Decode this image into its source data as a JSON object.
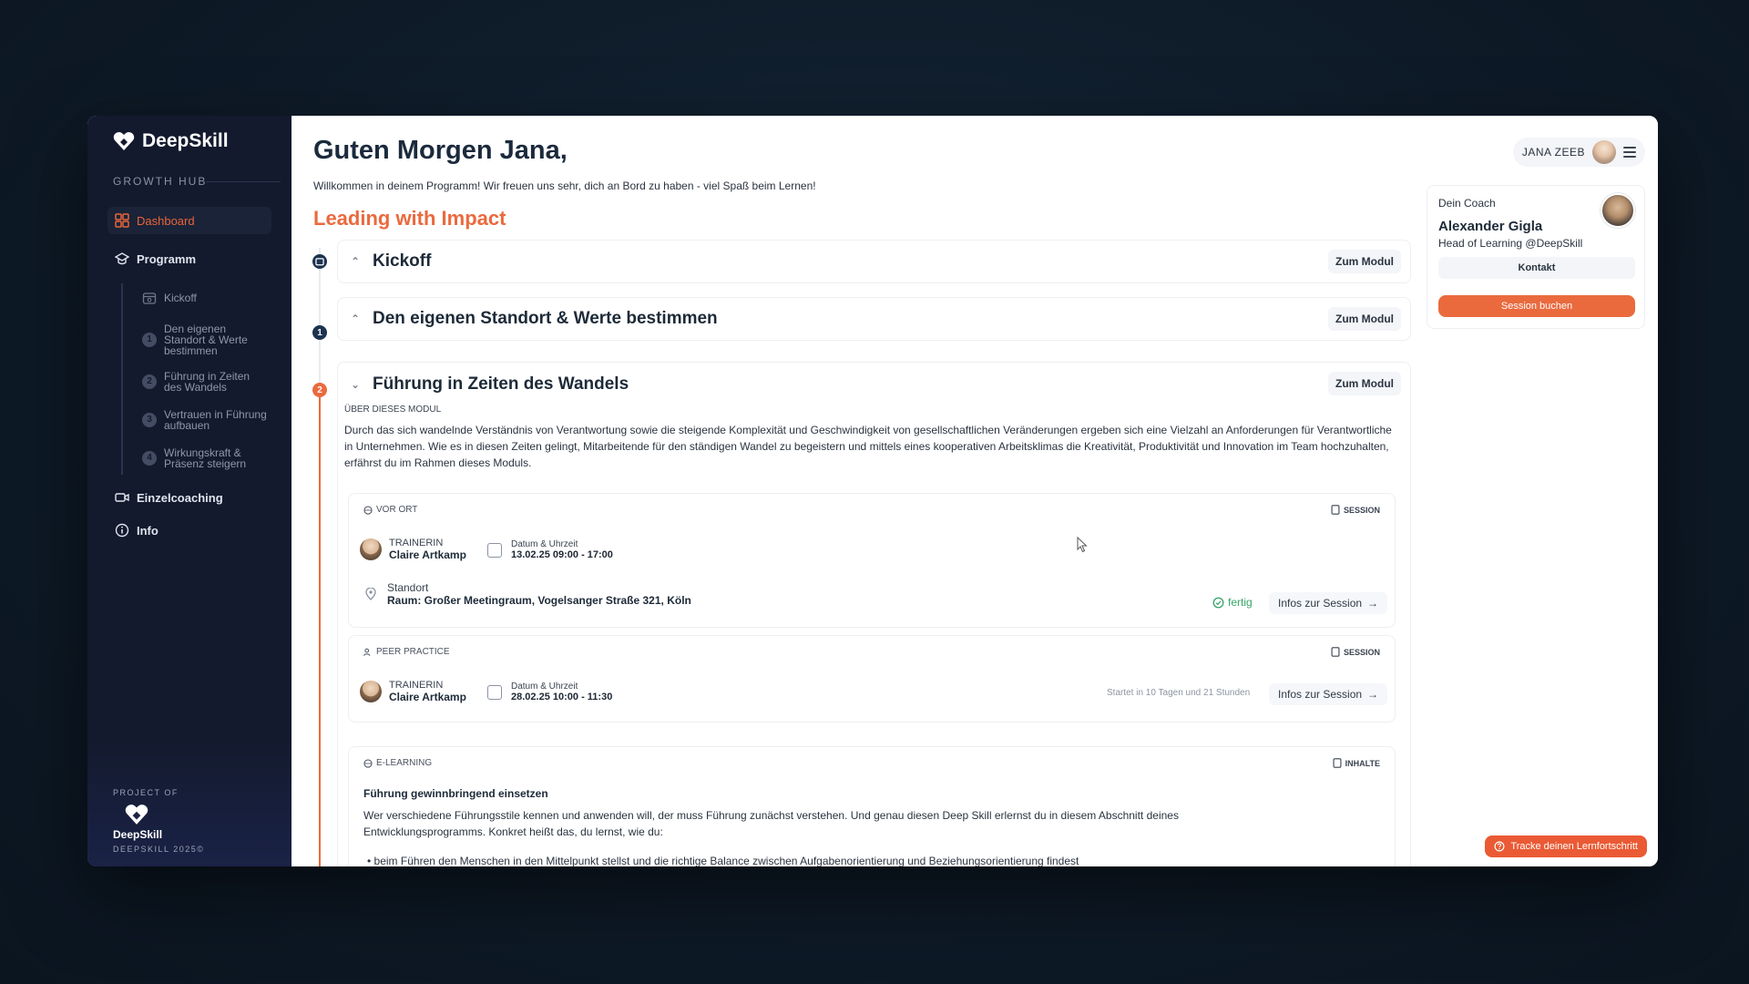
{
  "sidebar": {
    "brand": "DeepSkill",
    "section_label": "GROWTH HUB",
    "nav": {
      "dashboard": "Dashboard",
      "programm": "Programm",
      "einzelcoaching": "Einzelcoaching",
      "info": "Info"
    },
    "sub_items": [
      {
        "icon": "calendar-icon",
        "label": "Kickoff"
      },
      {
        "num": "1",
        "label": "Den eigenen Standort & Werte bestimmen"
      },
      {
        "num": "2",
        "label": "Führung in Zeiten des Wandels"
      },
      {
        "num": "3",
        "label": "Vertrauen in Führung aufbauen"
      },
      {
        "num": "4",
        "label": "Wirkungskraft & Präsenz steigern"
      }
    ],
    "project_of": "PROJECT OF",
    "project_brand": "DeepSkill",
    "project_copy": "DEEPSKILL 2025©"
  },
  "header": {
    "greeting": "Guten Morgen Jana,",
    "welcome": "Willkommen in deinem Programm! Wir freuen uns sehr, dich an Bord zu haben - viel Spaß beim Lernen!",
    "program_title": "Leading with Impact",
    "user_name": "JANA ZEEB"
  },
  "modules": [
    {
      "step": "0",
      "title": "Kickoff",
      "button": "Zum Modul"
    },
    {
      "step": "1",
      "title": "Den eigenen Standort & Werte bestimmen",
      "button": "Zum Modul"
    },
    {
      "step": "2",
      "title": "Führung in Zeiten des Wandels",
      "button": "Zum Modul"
    }
  ],
  "module_detail": {
    "about_label": "ÜBER DIESES MODUL",
    "about_text": "Durch das sich wandelnde Verständnis von Verantwortung sowie die steigende Komplexität und Geschwindigkeit von gesellschaftlichen Veränderungen ergeben sich eine Vielzahl an Anforderungen für Verantwortliche in Unternehmen. Wie es in diesen Zeiten gelingt, Mitarbeitende für den ständigen Wandel zu begeistern und mittels eines kooperativen Arbeitsklimas die Kreativität, Produktivität und Innovation im Team hochzuhalten, erfährst du im Rahmen dieses Moduls.",
    "sessions": [
      {
        "tag": "VOR ORT",
        "type": "SESSION",
        "trainer_label": "TRAINERIN",
        "trainer_name": "Claire Artkamp",
        "date_label": "Datum & Uhrzeit",
        "date_value": "13.02.25  09:00 - 17:00",
        "location_label": "Standort",
        "location_value": "Raum: Großer Meetingraum, Vogelsanger Straße 321, Köln",
        "status": "fertig",
        "info_button": "Infos zur Session"
      },
      {
        "tag": "PEER PRACTICE",
        "type": "SESSION",
        "trainer_label": "TRAINERIN",
        "trainer_name": "Claire Artkamp",
        "date_label": "Datum & Uhrzeit",
        "date_value": "28.02.25  10:00 - 11:30",
        "starts_in": "Startet in 10 Tagen und 21 Stunden",
        "info_button": "Infos zur Session"
      }
    ],
    "elearning": {
      "tag": "E-LEARNING",
      "type": "INHALTE",
      "title": "Führung gewinnbringend einsetzen",
      "text": "Wer verschiedene Führungsstile kennen und anwenden will, der muss Führung zunächst verstehen. Und genau diesen Deep Skill erlernst du in diesem Abschnitt deines Entwicklungsprogramms. Konkret heißt das, du lernst, wie du:",
      "bullet": "beim Führen den Menschen in den Mittelpunkt stellst und die richtige Balance zwischen Aufgabenorientierung und Beziehungsorientierung findest"
    }
  },
  "coach": {
    "label": "Dein Coach",
    "name": "Alexander Gigla",
    "role": "Head of Learning @DeepSkill",
    "contact_button": "Kontakt",
    "book_button": "Session buchen"
  },
  "track_button": "Tracke deinen Lernfortschritt",
  "colors": {
    "accent": "#ea6a3e",
    "sidebar_bg": "#131a2e",
    "success": "#36a467"
  }
}
